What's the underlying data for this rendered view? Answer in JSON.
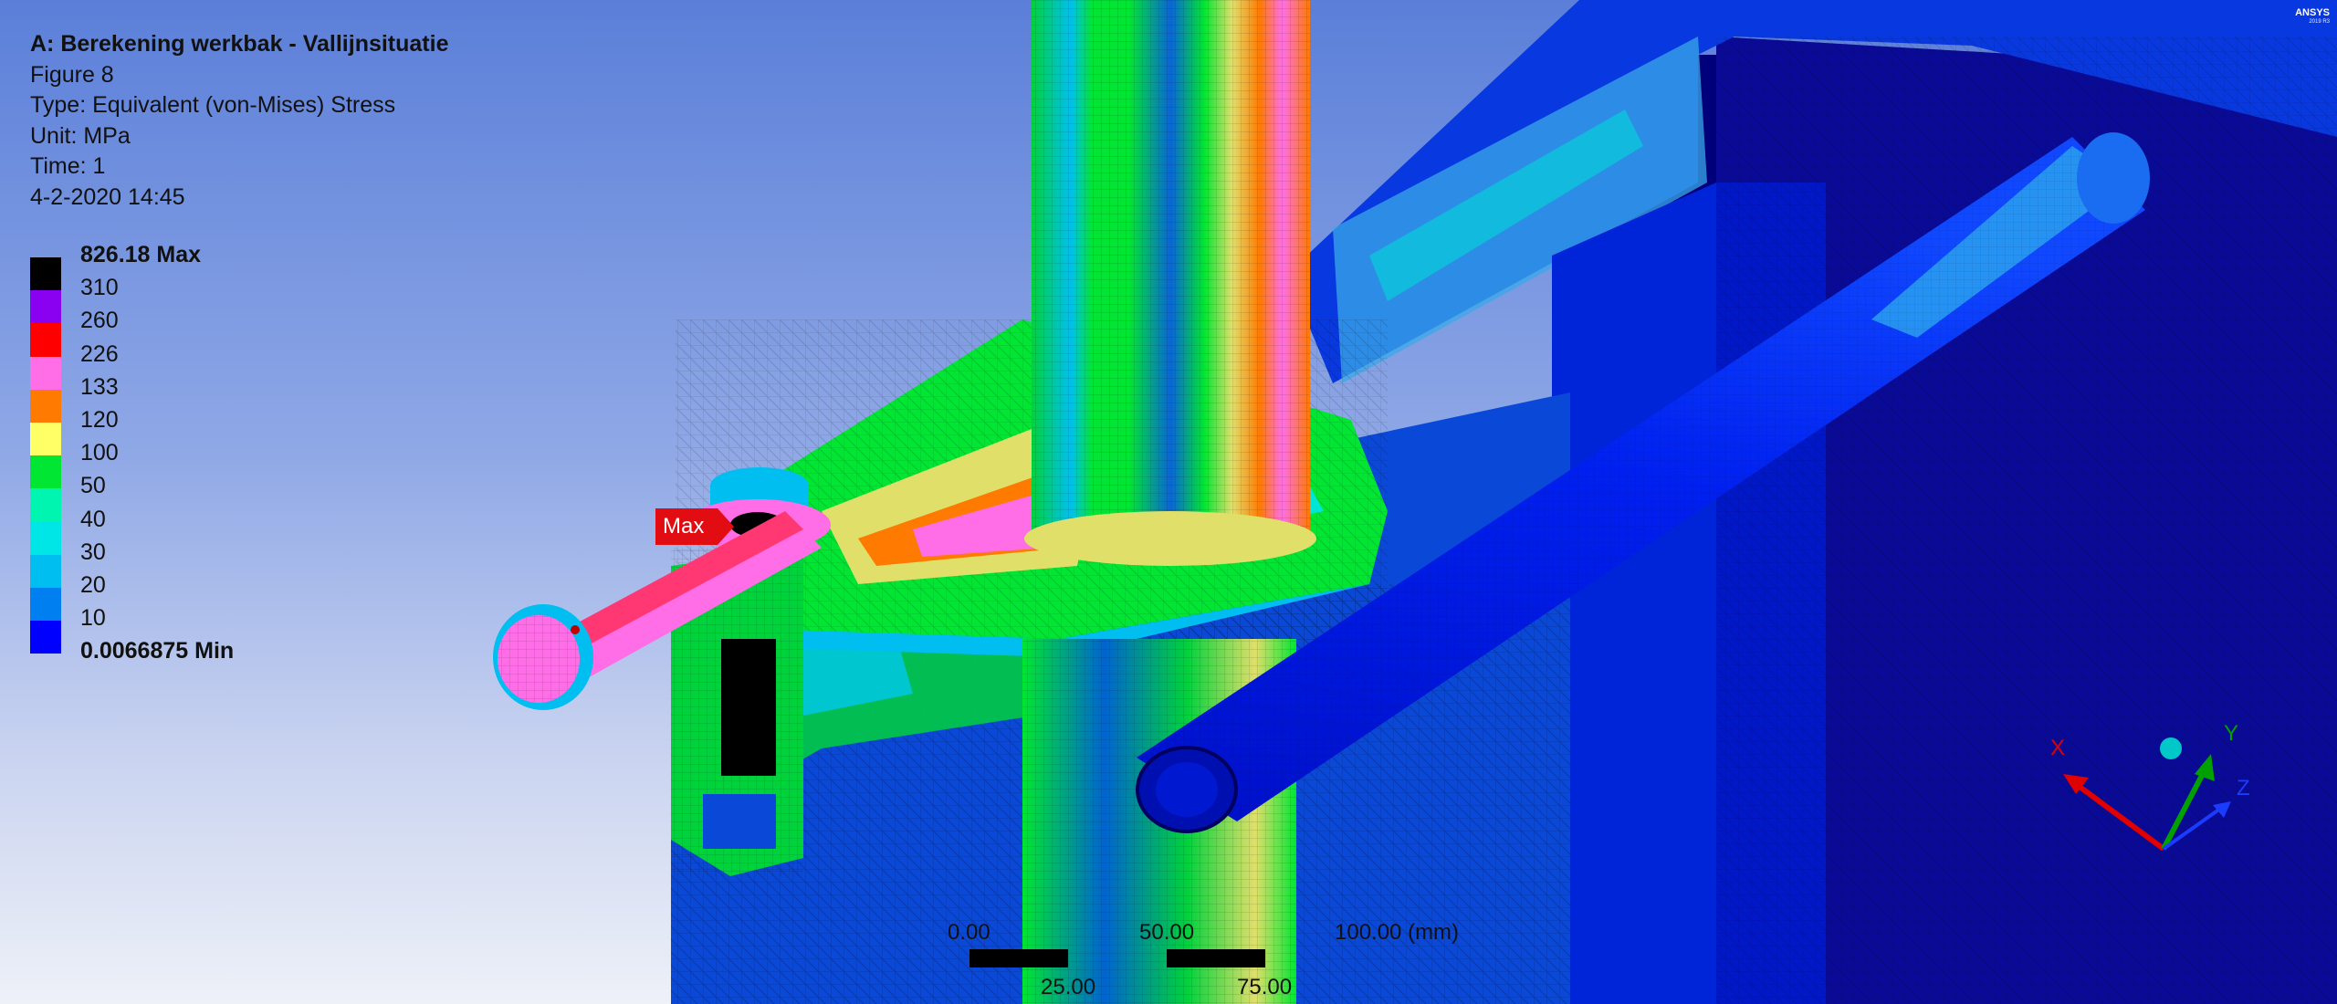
{
  "info": {
    "title": "A: Berekening werkbak - Vallijnsituatie",
    "figure": "Figure 8",
    "type": "Type: Equivalent (von-Mises) Stress",
    "unit": "Unit: MPa",
    "time": "Time: 1",
    "timestamp": "4-2-2020 14:45"
  },
  "legend": {
    "max_label": "826.18 Max",
    "min_label": "0.0066875 Min",
    "levels": [
      "310",
      "260",
      "226",
      "133",
      "120",
      "100",
      "50",
      "40",
      "30",
      "20",
      "10"
    ],
    "colors": [
      "#000000",
      "#8a00f0",
      "#ff0000",
      "#ff6ee6",
      "#ff7a00",
      "#ffff66",
      "#00e632",
      "#00f5b0",
      "#00e5e5",
      "#00bff0",
      "#0080f0",
      "#0000ff"
    ]
  },
  "probe": {
    "label": "Max",
    "color": "#e10d12"
  },
  "scale_bar": {
    "top_labels": [
      "0.00",
      "50.00",
      "100.00 (mm)"
    ],
    "bottom_labels": [
      "25.00",
      "75.00"
    ]
  },
  "triad": {
    "x_label": "X",
    "y_label": "Y",
    "z_label": "Z",
    "x_color": "#e00000",
    "y_color": "#00a000",
    "z_color": "#1a3cff"
  },
  "logo": {
    "text": "ANSYS",
    "version": "2019 R3"
  }
}
